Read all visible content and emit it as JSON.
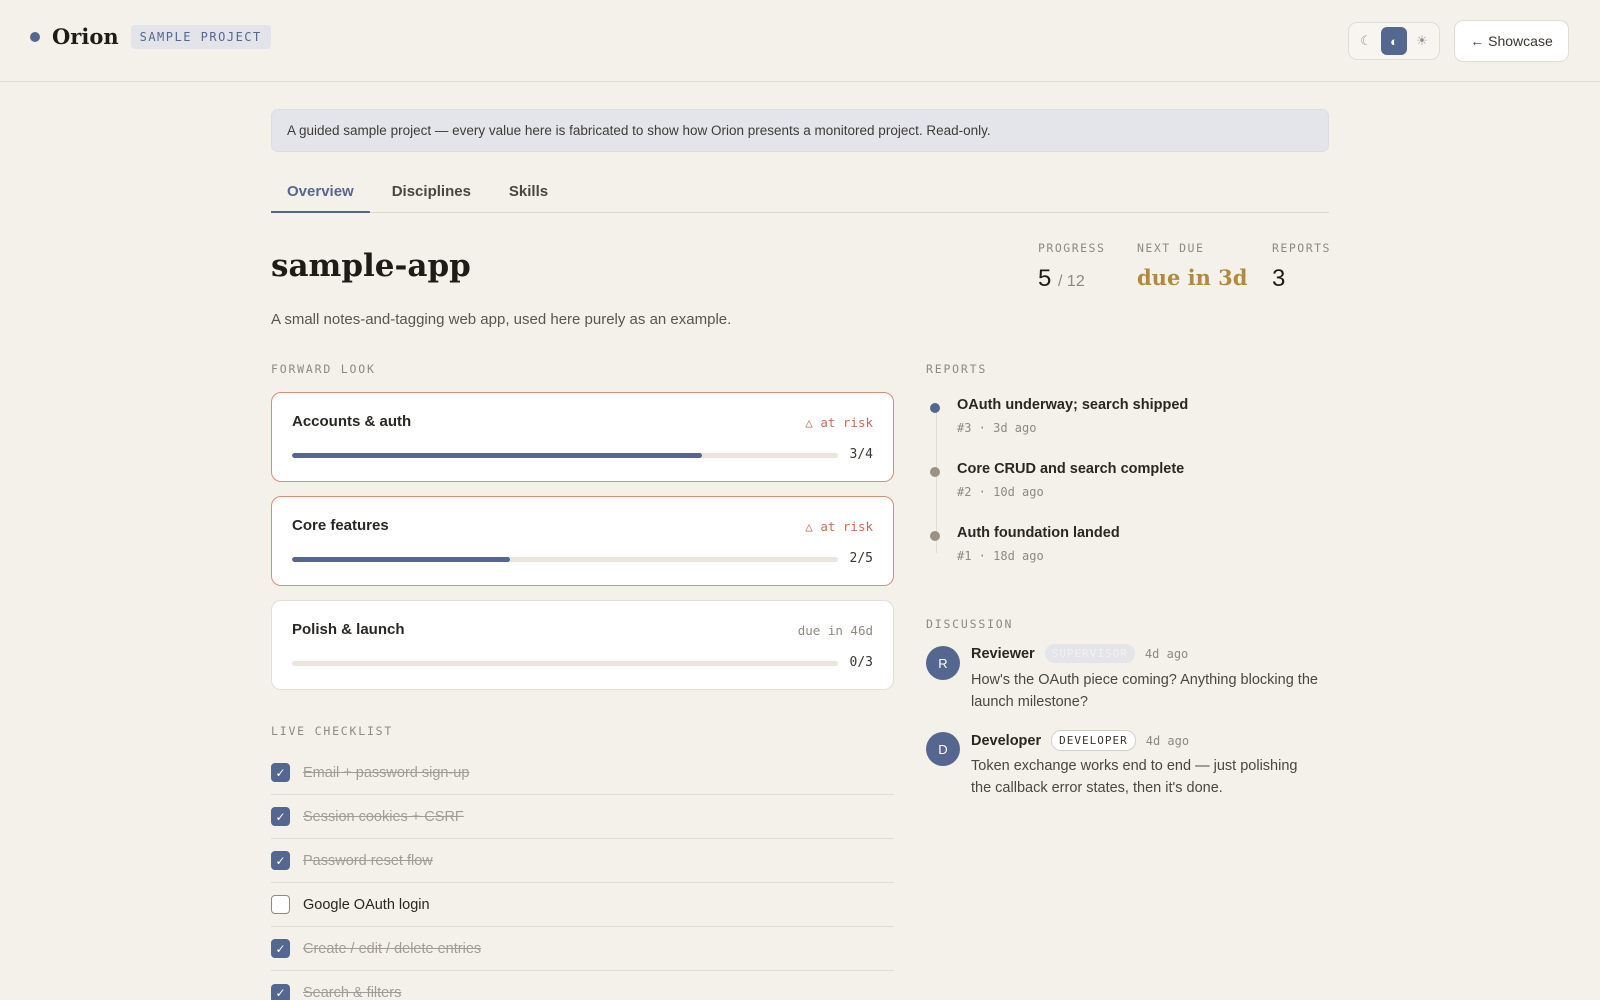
{
  "header": {
    "brand": "Orion",
    "badge": "SAMPLE PROJECT",
    "theme_options": [
      {
        "icon": "moon-icon",
        "glyph": "☾"
      },
      {
        "icon": "auto-theme-icon",
        "glyph": "◐"
      },
      {
        "icon": "sun-icon",
        "glyph": "☀"
      }
    ],
    "showcase_label": "← Showcase"
  },
  "notice": "A guided sample project — every value here is fabricated to show how Orion presents a monitored project. Read-only.",
  "tabs": [
    "Overview",
    "Disciplines",
    "Skills"
  ],
  "project": {
    "name": "sample-app",
    "description": "A small notes-and-tagging web app, used here purely as an example."
  },
  "stats": {
    "progress_label": "PROGRESS",
    "progress_value": "5",
    "progress_total": "/ 12",
    "next_due_label": "NEXT DUE",
    "next_due_value": "due in 3d",
    "reports_label": "REPORTS",
    "reports_value": "3"
  },
  "sections": {
    "forward_look": "FORWARD LOOK",
    "live_checklist": "LIVE CHECKLIST",
    "reports": "REPORTS",
    "discussion": "DISCUSSION"
  },
  "milestones": [
    {
      "name": "Accounts & auth",
      "status": "△ at risk",
      "at_risk": true,
      "done": 3,
      "total": 4,
      "count": "3/4"
    },
    {
      "name": "Core features",
      "status": "△ at risk",
      "at_risk": true,
      "done": 2,
      "total": 5,
      "count": "2/5"
    },
    {
      "name": "Polish & launch",
      "status": "due in 46d",
      "at_risk": false,
      "done": 0,
      "total": 3,
      "count": "0/3"
    }
  ],
  "checklist": [
    {
      "text": "Email + password sign-up",
      "checked": true
    },
    {
      "text": "Session cookies + CSRF",
      "checked": true
    },
    {
      "text": "Password reset flow",
      "checked": true
    },
    {
      "text": "Google OAuth login",
      "checked": false
    },
    {
      "text": "Create / edit / delete entries",
      "checked": true
    },
    {
      "text": "Search & filters",
      "checked": true
    }
  ],
  "reports": [
    {
      "title": "OAuth underway; search shipped",
      "meta": "#3 · 3d ago",
      "latest": true
    },
    {
      "title": "Core CRUD and search complete",
      "meta": "#2 · 10d ago",
      "latest": false
    },
    {
      "title": "Auth foundation landed",
      "meta": "#1 · 18d ago",
      "latest": false
    }
  ],
  "comments": [
    {
      "initial": "R",
      "author": "Reviewer",
      "role": "SUPERVISOR",
      "time": "4d ago",
      "body": "How's the OAuth piece coming? Anything blocking the launch milestone?"
    },
    {
      "initial": "D",
      "author": "Developer",
      "role": "DEVELOPER",
      "time": "4d ago",
      "body": "Token exchange works end to end — just polishing the callback error states, then it's done."
    }
  ]
}
